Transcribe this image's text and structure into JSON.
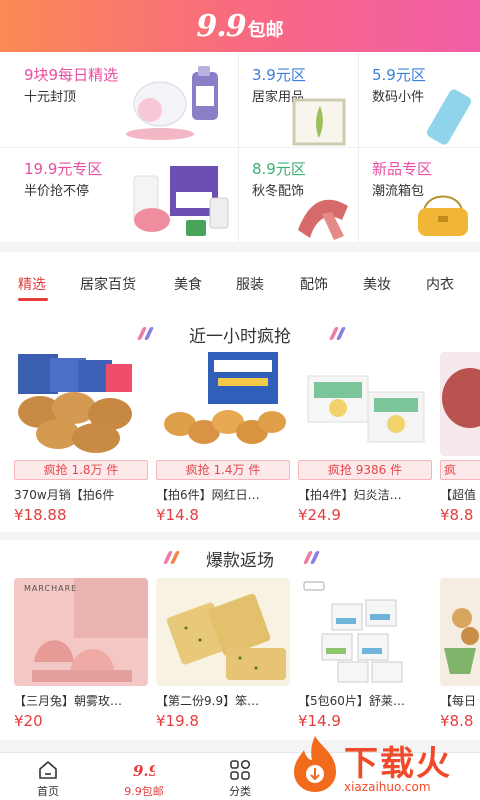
{
  "header": {
    "logo_number": "9.9",
    "logo_text": "包邮",
    "accent": "#f86a80"
  },
  "promo": {
    "cells": [
      {
        "title": "9块9每日精选",
        "subtitle": "十元封顶",
        "title_color": "#e84fa0"
      },
      {
        "title": "3.9元区",
        "subtitle": "居家用品",
        "title_color": "#3d7fd8"
      },
      {
        "title": "5.9元区",
        "subtitle": "数码小件",
        "title_color": "#3d7fd8"
      },
      {
        "title": "19.9元专区",
        "subtitle": "半价抢不停",
        "title_color": "#e84fa0"
      },
      {
        "title": "8.9元区",
        "subtitle": "秋冬配饰",
        "title_color": "#3bb26f"
      },
      {
        "title": "新品专区",
        "subtitle": "潮流箱包",
        "title_color": "#e84fa0"
      }
    ]
  },
  "tabs": [
    "精选",
    "居家百货",
    "美食",
    "服装",
    "配饰",
    "美妆",
    "内衣"
  ],
  "flash_sale": {
    "title": "近一小时疯抢",
    "items": [
      {
        "badge": "疯抢 1.8万 件",
        "name": "370w月销【拍6件",
        "price": "¥18.88"
      },
      {
        "badge": "疯抢 1.4万 件",
        "name": "【拍6件】网红日…",
        "price": "¥14.8"
      },
      {
        "badge": "疯抢 9386 件",
        "name": "【拍4件】妇炎洁…",
        "price": "¥24.9"
      },
      {
        "badge": "疯",
        "name": "【超值",
        "price": "¥8.8"
      }
    ]
  },
  "hot_return": {
    "title": "爆款返场",
    "items": [
      {
        "name": "【三月兔】朝雾玫…",
        "price": "¥20",
        "brand": "MARCHARE"
      },
      {
        "name": "【第二份9.9】笨…",
        "price": "¥19.8"
      },
      {
        "name": "【5包60片】舒莱…",
        "price": "¥14.9"
      },
      {
        "name": "【每日",
        "price": "¥8.8"
      }
    ]
  },
  "bottom_nav": [
    {
      "label": "首页",
      "icon": "home-icon"
    },
    {
      "label": "9.9包邮",
      "icon": "free-shipping-icon"
    },
    {
      "label": "分类",
      "icon": "category-grid-icon"
    }
  ],
  "watermark": {
    "text": "下载火",
    "url": "xiazaihuo.com"
  }
}
